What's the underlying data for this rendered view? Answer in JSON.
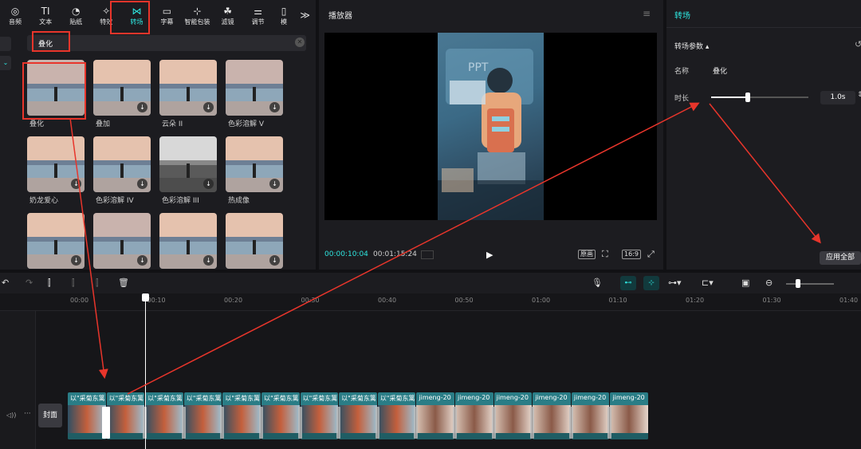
{
  "toolbar": {
    "tabs": [
      {
        "label": "音频",
        "icon": "audio-icon"
      },
      {
        "label": "文本",
        "icon": "text-icon"
      },
      {
        "label": "贴纸",
        "icon": "sticker-icon"
      },
      {
        "label": "特效",
        "icon": "effects-icon"
      },
      {
        "label": "转场",
        "icon": "transition-icon",
        "active": true
      },
      {
        "label": "字幕",
        "icon": "subtitle-icon"
      },
      {
        "label": "智能包装",
        "icon": "smart-package-icon"
      },
      {
        "label": "滤镜",
        "icon": "filter-icon"
      },
      {
        "label": "调节",
        "icon": "adjust-icon"
      },
      {
        "label": "模",
        "icon": "template-icon"
      }
    ],
    "more_label": "≫"
  },
  "media": {
    "search_value": "叠化",
    "clear_icon": "close-icon",
    "items": [
      {
        "label": "叠化",
        "download": false
      },
      {
        "label": "叠加",
        "download": true
      },
      {
        "label": "云朵 II",
        "download": true
      },
      {
        "label": "色彩溶解 V",
        "download": true
      },
      {
        "label": "奶龙爱心",
        "download": true
      },
      {
        "label": "色彩溶解 IV",
        "download": true
      },
      {
        "label": "色彩溶解 III",
        "download": true
      },
      {
        "label": "热成像",
        "download": true
      },
      {
        "label": "",
        "download": true
      },
      {
        "label": "",
        "download": true
      },
      {
        "label": "",
        "download": true
      },
      {
        "label": "",
        "download": true
      }
    ]
  },
  "player": {
    "title": "播放器",
    "current_time": "00:00:10:04",
    "total_time": "00:01:15:24",
    "btn_original": "原画",
    "btn_ratio": "16:9"
  },
  "transition_panel": {
    "title": "转场",
    "params_label": "转场参数 ▴",
    "name_label": "名称",
    "name_value": "叠化",
    "duration_label": "时长",
    "duration_value": "1.0s",
    "duration_slider_fraction": 0.38,
    "apply_all": "应用全部"
  },
  "timeline": {
    "ticks": [
      "00:00",
      "00:10",
      "00:20",
      "00:30",
      "00:40",
      "00:50",
      "01:00",
      "01:10",
      "01:20",
      "01:30",
      "01:40"
    ],
    "cover_label": "封面",
    "clips": [
      "以\"采菊东篱",
      "以\"采菊东篱",
      "以\"采菊东篱",
      "以\"采菊东篱",
      "以\"采菊东篱",
      "以\"采菊东篱",
      "以\"采菊东篱",
      "以\"采菊东篱",
      "以\"采菊东篱",
      "jimeng-20",
      "jimeng-20",
      "jimeng-20",
      "jimeng-20",
      "jimeng-20",
      "jimeng-20"
    ]
  },
  "colors": {
    "accent": "#2ee6e0",
    "annotation": "#e8352b",
    "panel_bg": "#1c1c20"
  }
}
